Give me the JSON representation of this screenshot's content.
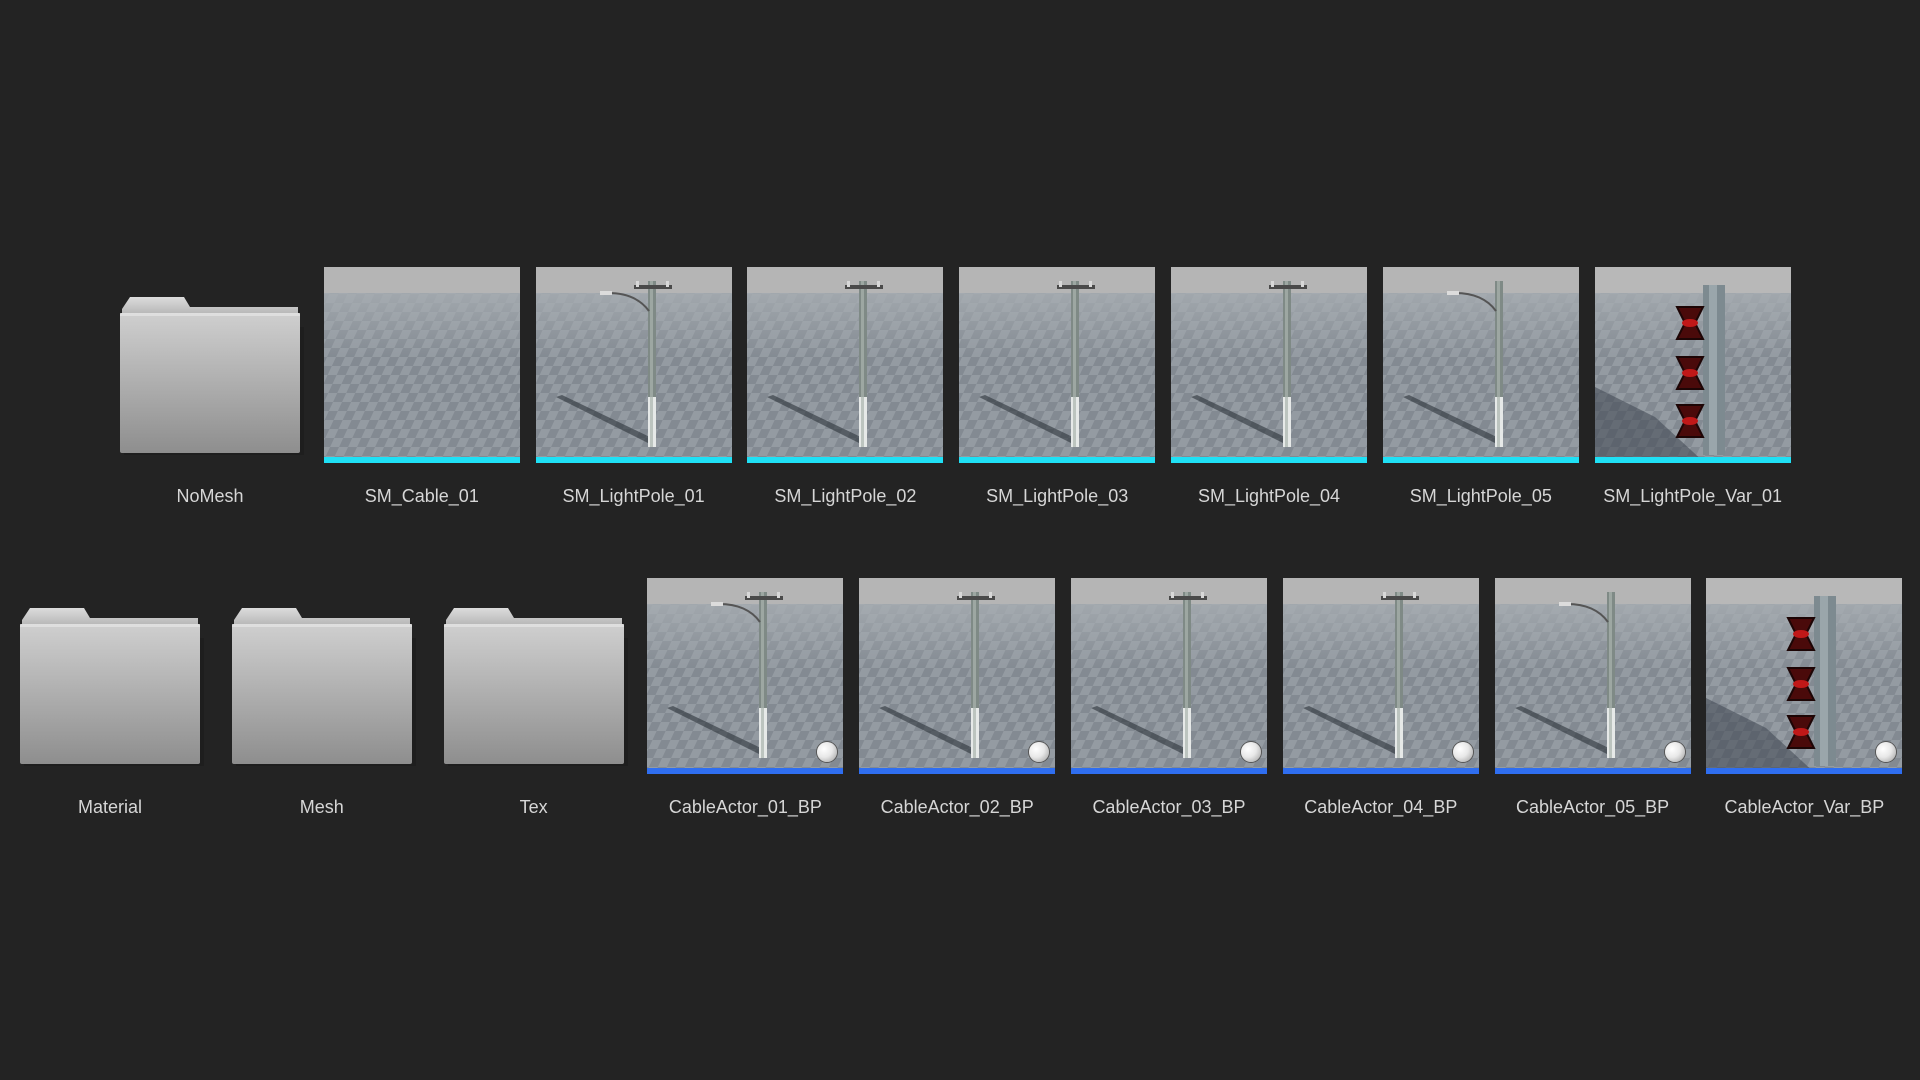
{
  "row1": [
    {
      "kind": "folder",
      "label": "NoMesh",
      "icon": "folder-icon"
    },
    {
      "kind": "mesh",
      "variant": "empty",
      "label": "SM_Cable_01",
      "icon": "static-mesh-thumbnail"
    },
    {
      "kind": "mesh",
      "variant": "lamp",
      "label": "SM_LightPole_01",
      "icon": "static-mesh-thumbnail"
    },
    {
      "kind": "mesh",
      "variant": "pole",
      "label": "SM_LightPole_02",
      "icon": "static-mesh-thumbnail"
    },
    {
      "kind": "mesh",
      "variant": "pole",
      "label": "SM_LightPole_03",
      "icon": "static-mesh-thumbnail"
    },
    {
      "kind": "mesh",
      "variant": "pole",
      "label": "SM_LightPole_04",
      "icon": "static-mesh-thumbnail"
    },
    {
      "kind": "mesh",
      "variant": "lamp-single",
      "label": "SM_LightPole_05",
      "icon": "static-mesh-thumbnail"
    },
    {
      "kind": "mesh",
      "variant": "insulators",
      "label": "SM_LightPole_Var_01",
      "icon": "static-mesh-thumbnail"
    }
  ],
  "row2": [
    {
      "kind": "folder",
      "label": "Material",
      "icon": "folder-icon"
    },
    {
      "kind": "folder",
      "label": "Mesh",
      "icon": "folder-icon"
    },
    {
      "kind": "folder",
      "label": "Tex",
      "icon": "folder-icon"
    },
    {
      "kind": "bp",
      "variant": "lamp",
      "label": "CableActor_01_BP",
      "icon": "blueprint-thumbnail"
    },
    {
      "kind": "bp",
      "variant": "pole",
      "label": "CableActor_02_BP",
      "icon": "blueprint-thumbnail"
    },
    {
      "kind": "bp",
      "variant": "pole",
      "label": "CableActor_03_BP",
      "icon": "blueprint-thumbnail"
    },
    {
      "kind": "bp",
      "variant": "pole",
      "label": "CableActor_04_BP",
      "icon": "blueprint-thumbnail"
    },
    {
      "kind": "bp",
      "variant": "lamp-single",
      "label": "CableActor_05_BP",
      "icon": "blueprint-thumbnail"
    },
    {
      "kind": "bp",
      "variant": "insulators",
      "label": "CableActor_Var_BP",
      "icon": "blueprint-thumbnail"
    }
  ],
  "colors": {
    "background": "#232323",
    "mesh_bar": "#1fe0f5",
    "blueprint_bar": "#2f6ef0",
    "label_text": "#d6d6d6"
  }
}
